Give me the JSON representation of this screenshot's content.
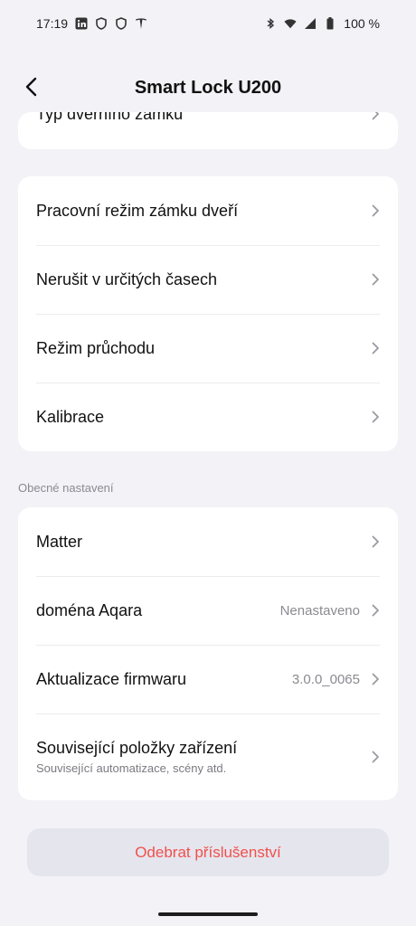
{
  "status_bar": {
    "time": "17:19",
    "battery": "100 %",
    "icons_left": [
      "linkedin-icon",
      "shield-icon",
      "shield-icon",
      "tesla-icon"
    ],
    "icons_right": [
      "bluetooth-icon",
      "wifi-icon",
      "signal-icon",
      "battery-icon"
    ]
  },
  "header": {
    "title": "Smart Lock U200"
  },
  "card_top": {
    "partial_item": "Typ dveřního zámku"
  },
  "card_lock": {
    "items": [
      {
        "label": "Pracovní režim zámku dveří"
      },
      {
        "label": "Nerušit v určitých časech"
      },
      {
        "label": "Režim průchodu"
      },
      {
        "label": "Kalibrace"
      }
    ]
  },
  "general": {
    "section_title": "Obecné nastavení",
    "items": [
      {
        "label": "Matter",
        "value": ""
      },
      {
        "label": "doména Aqara",
        "value": "Nenastaveno"
      },
      {
        "label": "Aktualizace firmwaru",
        "value": "3.0.0_0065"
      },
      {
        "label": "Související položky zařízení",
        "subtitle": "Související automatizace, scény atd."
      }
    ]
  },
  "remove_button": {
    "label": "Odebrat příslušenství",
    "color": "#f0504a"
  }
}
